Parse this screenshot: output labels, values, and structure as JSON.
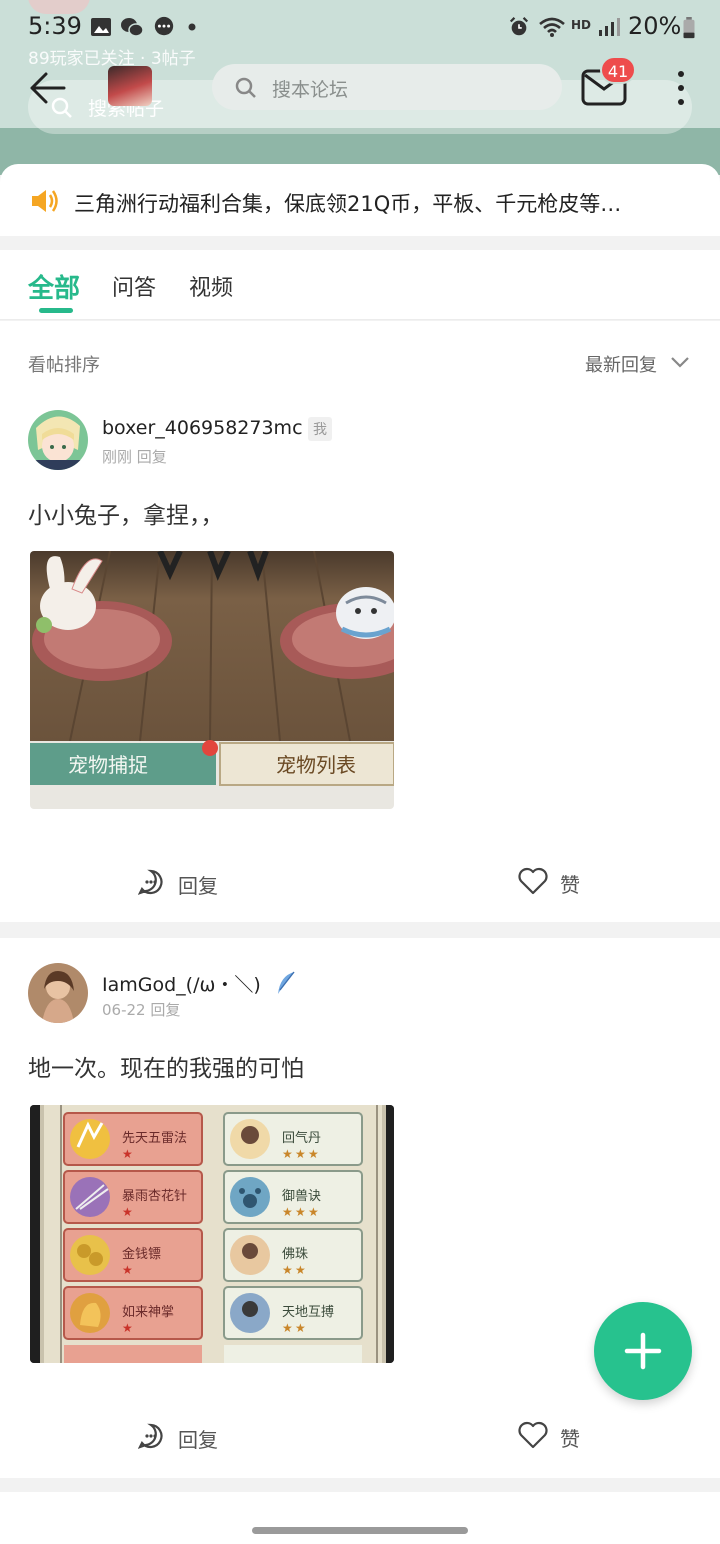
{
  "status_bar": {
    "time": "5:39",
    "battery": "20%",
    "network_label": "HD"
  },
  "header": {
    "followers_line": "89玩家已关注 · 3帖子",
    "ghost_search_text": "搜索帖子",
    "search_placeholder": "搜本论坛",
    "mail_badge_count": "41"
  },
  "notice": {
    "text": "三角洲行动福利合集，保底领21Q币，平板、千元枪皮等…"
  },
  "tabs": {
    "items": [
      {
        "label": "全部",
        "active": true
      },
      {
        "label": "问答",
        "active": false
      },
      {
        "label": "视频",
        "active": false
      }
    ]
  },
  "sort": {
    "label": "看帖排序",
    "selected": "最新回复"
  },
  "posts": [
    {
      "username": "boxer_406958273mc",
      "tag": "我",
      "meta": "刚刚 回复",
      "content": "小小兔子，拿捏，，",
      "image_buttons": [
        "宠物捕捉",
        "宠物列表"
      ],
      "reply_label": "回复",
      "like_label": "赞"
    },
    {
      "username": "IamGod_(/ω・＼)",
      "meta": "06-22 回复",
      "content": "地一次。现在的我强的可怕",
      "skills_left": [
        "先天五雷法",
        "暴雨杏花针",
        "金钱镖",
        "如来神掌"
      ],
      "skills_right": [
        "回气丹",
        "御兽诀",
        "佛珠",
        "天地互搏"
      ],
      "skills_right_stars": [
        3,
        3,
        2,
        2
      ],
      "reply_label": "回复",
      "like_label": "赞"
    }
  ],
  "colors": {
    "accent": "#27b98b",
    "header_bg": "#cbdfd8",
    "badge": "#ee4c4c",
    "fab": "#27c28e"
  }
}
